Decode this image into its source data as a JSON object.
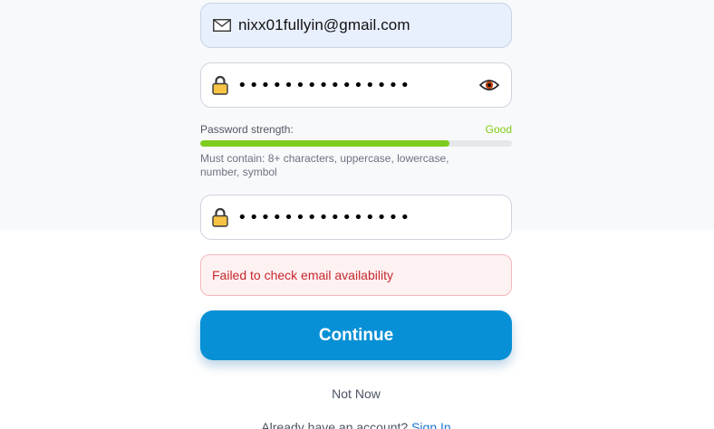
{
  "form": {
    "email_value": "nixx01fullyin@gmail.com",
    "password_masked": "•••••••••••••••",
    "confirm_masked": "•••••••••••••••",
    "icons": {
      "email": "envelope-icon",
      "password": "lock-icon",
      "toggle": "eye-icon",
      "confirm": "lock-icon"
    }
  },
  "strength": {
    "label": "Password strength:",
    "value": "Good",
    "level": 0.8,
    "color": "#84cc16",
    "requirements": "Must contain: 8+ characters, uppercase, lowercase, number, symbol"
  },
  "error": {
    "message": "Failed to check email availability"
  },
  "actions": {
    "continue_label": "Continue",
    "not_now_label": "Not Now"
  },
  "signin": {
    "prompt": "Already have an account? ",
    "link_label": "Sign In"
  },
  "colors": {
    "primary": "#0790d6",
    "error_text": "#c6282d",
    "link": "#1877d2"
  }
}
